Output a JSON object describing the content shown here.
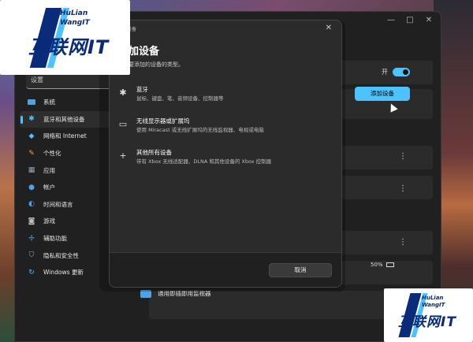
{
  "settings": {
    "search_placeholder": "设置",
    "window_controls": [
      "—",
      "□",
      "✕"
    ],
    "sidebar": [
      {
        "label": "系统",
        "icon": "display-icon",
        "active": false
      },
      {
        "label": "蓝牙和其他设备",
        "icon": "bluetooth-icon",
        "active": true
      },
      {
        "label": "网络和 Internet",
        "icon": "wifi-icon",
        "active": false
      },
      {
        "label": "个性化",
        "icon": "brush-icon",
        "active": false
      },
      {
        "label": "应用",
        "icon": "apps-icon",
        "active": false
      },
      {
        "label": "帐户",
        "icon": "person-icon",
        "active": false
      },
      {
        "label": "时间和语言",
        "icon": "globe-clock-icon",
        "active": false
      },
      {
        "label": "游戏",
        "icon": "gamepad-icon",
        "active": false
      },
      {
        "label": "辅助功能",
        "icon": "accessibility-icon",
        "active": false
      },
      {
        "label": "隐私和安全性",
        "icon": "shield-icon",
        "active": false
      },
      {
        "label": "Windows 更新",
        "icon": "update-icon",
        "active": false
      }
    ],
    "bluetooth_toggle_label": "开",
    "add_device_button": "添加设备",
    "battery_percent": "50%",
    "monitor_row_label": "通用即插即用监视器"
  },
  "dialog": {
    "titlebar": "设备",
    "close": "✕",
    "title": "加设备",
    "subtitle": "要添加的设备的类型。",
    "options": [
      {
        "title": "蓝牙",
        "desc": "鼠标、键盘、笔、音频设备、控制器等",
        "icon": "bluetooth-icon"
      },
      {
        "title": "无线显示器或扩展坞",
        "desc": "使用 Miracast 或无线扩展坞的无线监视器、电视或电脑",
        "icon": "monitor-icon"
      },
      {
        "title": "其他所有设备",
        "desc": "带有 Xbox 无线适配器、DLNA 和其他设备的 Xbox 控制器",
        "icon": "plus-icon"
      }
    ],
    "cancel_button": "取消"
  },
  "watermark": {
    "top_main": "互联网IT",
    "top_sub_1": "HuLian",
    "top_sub_2": "WangIT",
    "bottom_main": "互联网IT",
    "bottom_sub_1": "HuLian",
    "bottom_sub_2": "WangIT"
  },
  "colors": {
    "accent": "#4cc2ff",
    "logo": "#0a2b79"
  }
}
